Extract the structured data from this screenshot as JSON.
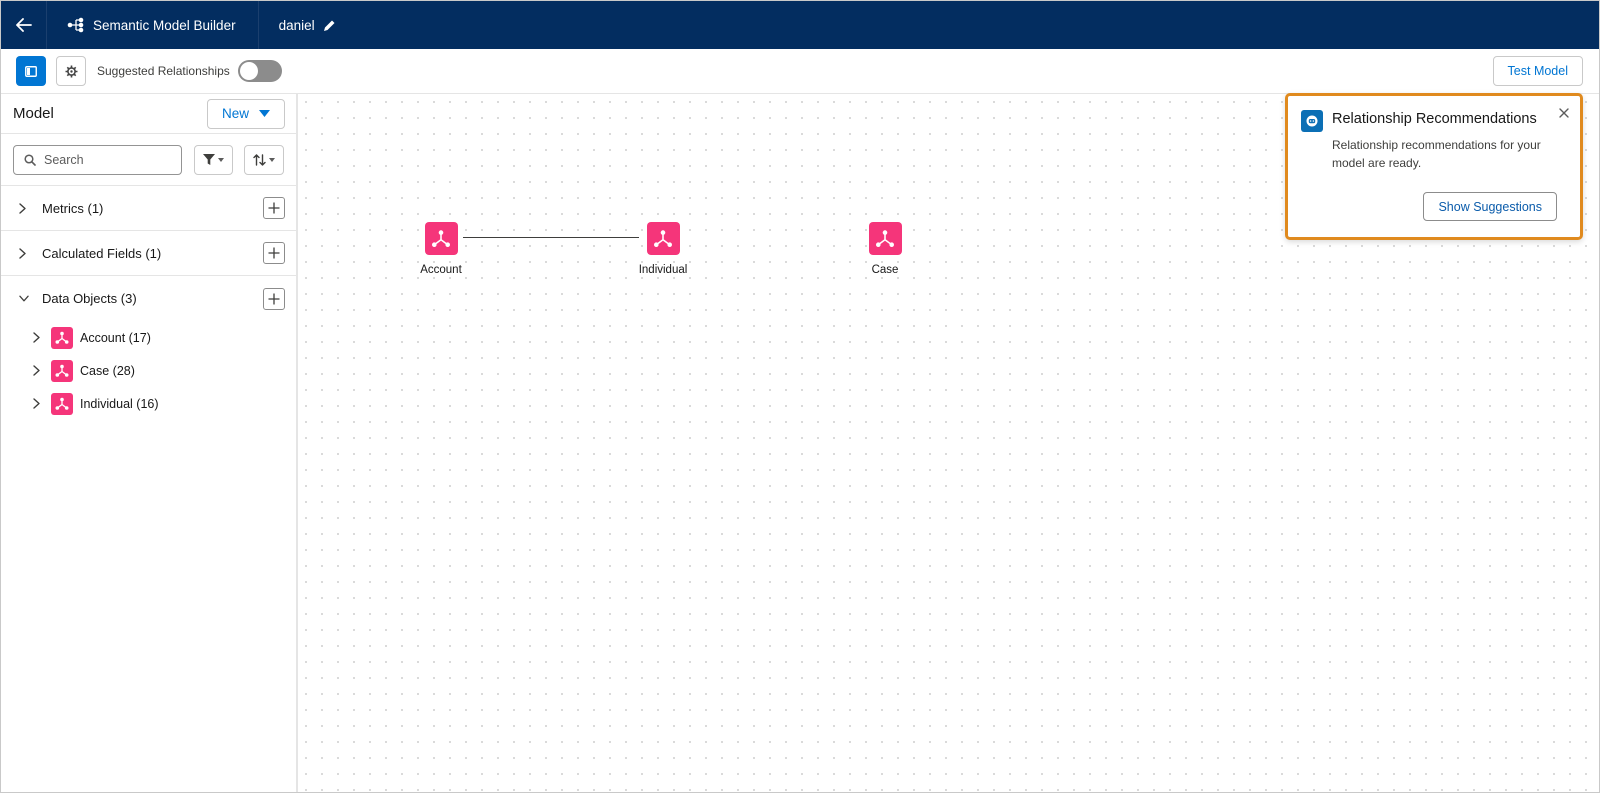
{
  "header": {
    "back_icon": "arrow-left-icon",
    "app_icon": "hierarchy-icon",
    "app_title": "Semantic Model Builder",
    "model_name": "daniel",
    "edit_icon": "pencil-icon"
  },
  "toolbar": {
    "panel_icon": "left-panel-icon",
    "settings_icon": "gear-icon",
    "suggested_label": "Suggested Relationships",
    "suggested_enabled": false,
    "test_model_label": "Test Model"
  },
  "sidebar": {
    "title": "Model",
    "new_label": "New",
    "search_placeholder": "Search",
    "sections": [
      {
        "label": "Metrics (1)",
        "expanded": false
      },
      {
        "label": "Calculated Fields (1)",
        "expanded": false
      },
      {
        "label": "Data Objects (3)",
        "expanded": true
      }
    ],
    "objects": [
      {
        "label": "Account (17)"
      },
      {
        "label": "Case (28)"
      },
      {
        "label": "Individual (16)"
      }
    ]
  },
  "canvas": {
    "nodes": [
      {
        "label": "Account"
      },
      {
        "label": "Individual"
      },
      {
        "label": "Case"
      }
    ]
  },
  "popover": {
    "title": "Relationship Recommendations",
    "body": "Relationship recommendations for your model are ready.",
    "button_label": "Show Suggestions",
    "highlight_color": "#e08a1e"
  },
  "colors": {
    "header_bg": "#032d60",
    "brand_blue": "#0176d3",
    "object_pink": "#f5357a"
  }
}
